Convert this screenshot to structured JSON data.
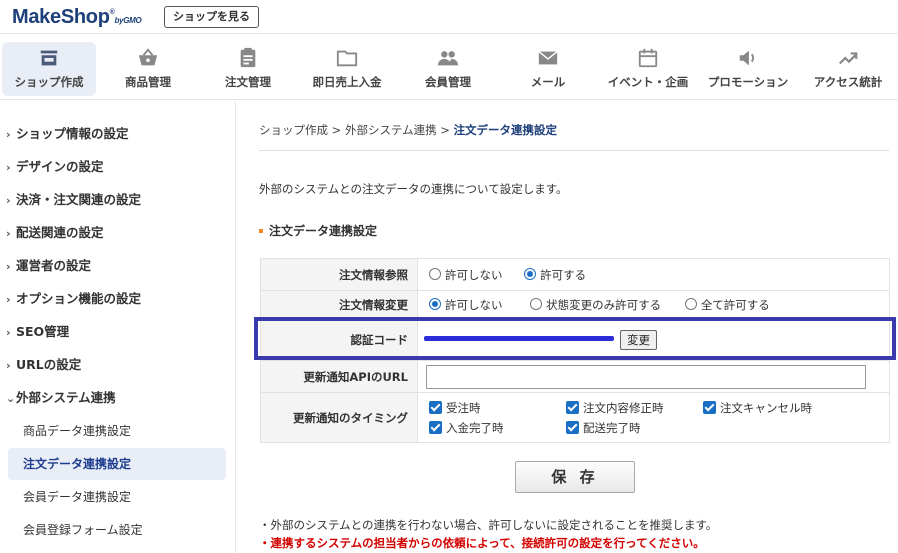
{
  "header": {
    "logo_main": "MakeShop",
    "logo_reg": "®",
    "logo_by": "by",
    "logo_gmo": "GMO",
    "view_shop_button": "ショップを見る"
  },
  "nav": [
    {
      "label": "ショップ作成",
      "icon": "store-icon",
      "active": true
    },
    {
      "label": "商品管理",
      "icon": "basket-icon"
    },
    {
      "label": "注文管理",
      "icon": "clipboard-icon"
    },
    {
      "label": "即日売上入金",
      "icon": "folder-icon"
    },
    {
      "label": "会員管理",
      "icon": "users-icon"
    },
    {
      "label": "メール",
      "icon": "mail-icon"
    },
    {
      "label": "イベント・企画",
      "icon": "calendar-icon"
    },
    {
      "label": "プロモーション",
      "icon": "speaker-icon"
    },
    {
      "label": "アクセス統計",
      "icon": "trend-icon"
    }
  ],
  "sidebar": {
    "items": [
      {
        "label": "ショップ情報の設定",
        "chevron": "›"
      },
      {
        "label": "デザインの設定",
        "chevron": "›"
      },
      {
        "label": "決済・注文関連の設定",
        "chevron": "›"
      },
      {
        "label": "配送関連の設定",
        "chevron": "›"
      },
      {
        "label": "運営者の設定",
        "chevron": "›"
      },
      {
        "label": "オプション機能の設定",
        "chevron": "›"
      },
      {
        "label": "SEO管理",
        "chevron": "›"
      },
      {
        "label": "URLの設定",
        "chevron": "›"
      },
      {
        "label": "外部システム連携",
        "chevron": "⌄"
      }
    ],
    "sub_items": [
      {
        "label": "商品データ連携設定"
      },
      {
        "label": "注文データ連携設定",
        "active": true
      },
      {
        "label": "会員データ連携設定"
      },
      {
        "label": "会員登録フォーム設定"
      }
    ]
  },
  "breadcrumb": {
    "part1": "ショップ作成",
    "sep": " > ",
    "part2": "外部システム連携",
    "current": "注文データ連携設定"
  },
  "main": {
    "description": "外部のシステムとの注文データの連携について設定します。",
    "section_title": "注文データ連携設定",
    "rows": {
      "order_ref": {
        "label": "注文情報参照",
        "options": [
          "許可しない",
          "許可する"
        ],
        "selected": 1
      },
      "order_change": {
        "label": "注文情報変更",
        "options": [
          "許可しない",
          "状態変更のみ許可する",
          "全て許可する"
        ],
        "selected": 0
      },
      "auth_code": {
        "label": "認証コード",
        "button": "変更"
      },
      "api_url": {
        "label": "更新通知APIのURL",
        "value": ""
      },
      "timing": {
        "label": "更新通知のタイミング",
        "checks": [
          "受注時",
          "注文内容修正時",
          "注文キャンセル時",
          "入金完了時",
          "配送完了時"
        ]
      }
    },
    "save_button": "保 存",
    "note1": "・外部のシステムとの連携を行わない場合、許可しないに設定されることを推奨します。",
    "note2": "・連携するシステムの担当者からの依頼によって、接続許可の設定を行ってください。"
  },
  "colors": {
    "accent": "#1a6fc4",
    "highlight_box": "#3a3aad",
    "warning": "#d40000",
    "brand": "#1d3f7a"
  }
}
